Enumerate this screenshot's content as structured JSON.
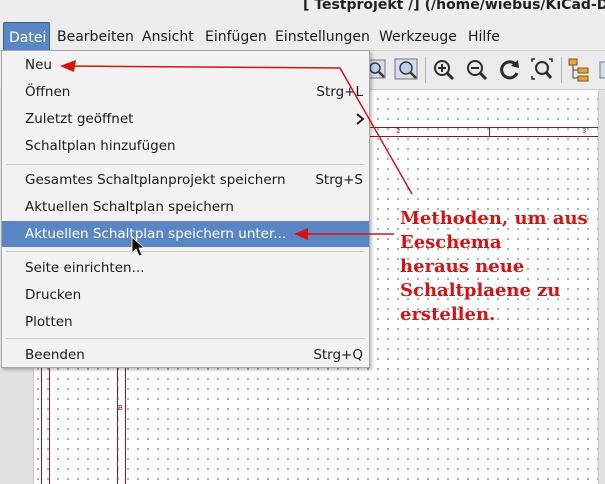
{
  "window": {
    "title": "[ Testprojekt /] (/home/wiebus/KiCad-Date"
  },
  "menubar": {
    "items": [
      "Datei",
      "Bearbeiten",
      "Ansicht",
      "Einfügen",
      "Einstellungen",
      "Werkzeuge",
      "Hilfe"
    ],
    "active": "Datei"
  },
  "toolbar": {
    "icons": [
      "zoom-area-icon",
      "zoom-page-icon",
      "zoom-in-icon",
      "zoom-out-icon",
      "redraw-icon",
      "zoom-fit-icon",
      "hierarchy-icon",
      "more-icon"
    ]
  },
  "file_menu": {
    "items": [
      {
        "label": "Neu",
        "shortcut": ""
      },
      {
        "label": "Öffnen",
        "shortcut": "Strg+L"
      },
      {
        "label": "Zuletzt geöffnet",
        "shortcut": "",
        "submenu": true
      },
      {
        "label": "Schaltplan hinzufügen",
        "shortcut": ""
      },
      {
        "label": "Gesamtes Schaltplanprojekt speichern",
        "shortcut": "Strg+S"
      },
      {
        "label": "Aktuellen Schaltplan speichern",
        "shortcut": ""
      },
      {
        "label": "Aktuellen Schaltplan speichern unter...",
        "shortcut": "",
        "highlighted": true
      },
      {
        "label": "Seite einrichten...",
        "shortcut": ""
      },
      {
        "label": "Drucken",
        "shortcut": ""
      },
      {
        "label": "Plotten",
        "shortcut": ""
      },
      {
        "label": "Beenden",
        "shortcut": "Strg+Q"
      }
    ],
    "highlight_color": "#5b86c4"
  },
  "canvas": {
    "frame_labels": [
      "2",
      "3",
      "B"
    ],
    "frame_color": "#8b1a1a"
  },
  "annotation": {
    "lines": [
      "Methoden, um aus",
      "Eeschema",
      "heraus neue",
      "Schaltplaene zu",
      "erstellen."
    ],
    "color": "#d41414"
  }
}
